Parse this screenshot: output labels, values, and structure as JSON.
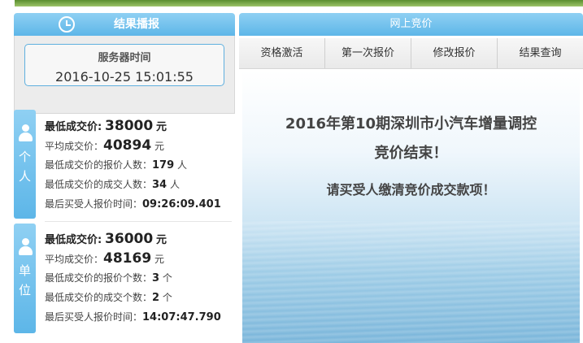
{
  "left_panel": {
    "header": "结果播报",
    "server_time_label": "服务器时间",
    "server_time_value": "2016-10-25 15:01:55"
  },
  "individual": {
    "side_label": [
      "个",
      "人"
    ],
    "min_price_label": "最低成交价:",
    "min_price_value": "38000",
    "min_price_unit": "元",
    "avg_price_label": "平均成交价：",
    "avg_price_value": "40894",
    "avg_price_unit": "元",
    "bidders_label": "最低成交价的报价人数：",
    "bidders_value": "179",
    "bidders_unit": "人",
    "winners_label": "最低成交价的成交人数：",
    "winners_value": "34",
    "winners_unit": "人",
    "last_time_label": "最后买受人报价时间：",
    "last_time_value": "09:26:09.401"
  },
  "unit": {
    "side_label": [
      "单",
      "位"
    ],
    "min_price_label": "最低成交价:",
    "min_price_value": "36000",
    "min_price_unit": "元",
    "avg_price_label": "平均成交价：",
    "avg_price_value": "48169",
    "avg_price_unit": "元",
    "bidders_label": "最低成交价的报价个数：",
    "bidders_value": "3",
    "bidders_unit": "个",
    "winners_label": "最低成交价的成交个数：",
    "winners_value": "2",
    "winners_unit": "个",
    "last_time_label": "最后买受人报价时间：",
    "last_time_value": "14:07:47.790"
  },
  "right_panel": {
    "header": "网上竞价",
    "tabs": [
      "资格激活",
      "第一次报价",
      "修改报价",
      "结果查询"
    ],
    "message_line1": "2016年第10期深圳市小汽车增量调控",
    "message_line2": "竞价结束！",
    "message_line3": "请买受人缴清竞价成交款项！"
  }
}
